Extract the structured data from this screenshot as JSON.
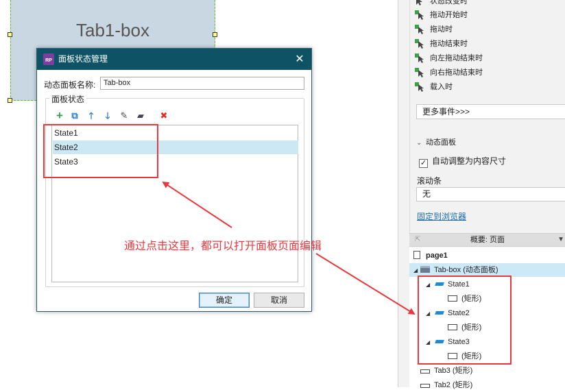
{
  "canvas": {
    "tab_box_label": "Tab1-box"
  },
  "right_panel": {
    "events": [
      "状态改变时",
      "拖动开始时",
      "拖动时",
      "拖动结束时",
      "向左拖动结束时",
      "向右拖动结束时",
      "载入时"
    ],
    "more_events": "更多事件>>>",
    "dynamic_panel_header": "动态面板",
    "auto_size_label": "自动调整为内容尺寸",
    "auto_size_checked": true,
    "scrollbar_label": "滚动条",
    "scrollbar_value": "无",
    "pin_link": "固定到浏览器",
    "outline": {
      "header": "概要: 页面",
      "items": [
        {
          "label": "page1",
          "type": "page"
        },
        {
          "label": "Tab-box (动态面板)",
          "type": "dynamic-panel"
        },
        {
          "label": "State1",
          "type": "state"
        },
        {
          "label": "(矩形)",
          "type": "rect"
        },
        {
          "label": "State2",
          "type": "state"
        },
        {
          "label": "(矩形)",
          "type": "rect"
        },
        {
          "label": "State3",
          "type": "state"
        },
        {
          "label": "(矩形)",
          "type": "rect"
        },
        {
          "label": "Tab3 (矩形)",
          "type": "rect"
        },
        {
          "label": "Tab2 (矩形)",
          "type": "rect"
        }
      ]
    }
  },
  "dialog": {
    "logo_text": "RP",
    "title": "面板状态管理",
    "close_glyph": "✕",
    "name_label": "动态面板名称:",
    "name_value": "Tab-box",
    "states_legend": "面板状态",
    "toolbar": {
      "add": "+",
      "duplicate": "⧉",
      "move_up": "🡑",
      "move_down": "🡓",
      "edit": "✎",
      "edit_all": "▰",
      "delete": "✖"
    },
    "states": [
      "State1",
      "State2",
      "State3"
    ],
    "selected_state": "State2",
    "ok_label": "确定",
    "cancel_label": "取消"
  },
  "annotation": {
    "text": "通过点击这里，都可以打开面板页面编辑",
    "color": "#e8383d"
  },
  "colors": {
    "dialog_title_bg": "#0e5365",
    "selection": "#cce8f4",
    "accent_blue": "#1e8ad6"
  }
}
